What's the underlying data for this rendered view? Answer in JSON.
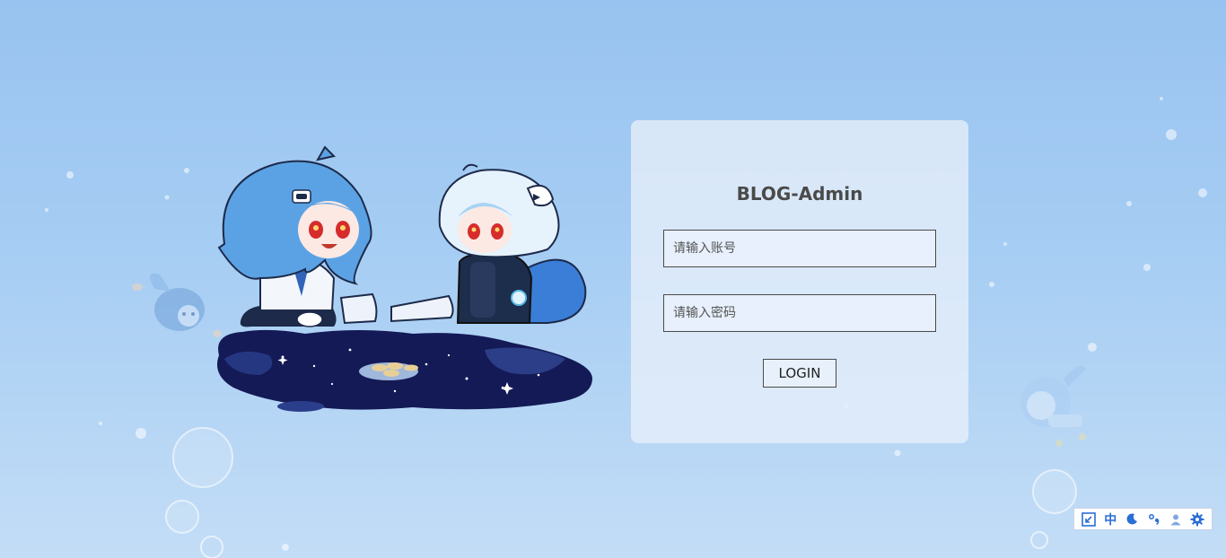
{
  "login": {
    "title": "BLOG-Admin",
    "account_placeholder": "请输入账号",
    "password_placeholder": "请输入密码",
    "submit_label": "LOGIN"
  },
  "ime_toolbar": {
    "items": [
      {
        "icon": "ime-switch-icon"
      },
      {
        "icon": "chinese-mode-icon",
        "label": "中"
      },
      {
        "icon": "half-width-moon-icon"
      },
      {
        "icon": "punctuation-icon"
      },
      {
        "icon": "user-icon"
      },
      {
        "icon": "settings-gear-icon"
      }
    ]
  },
  "colors": {
    "background_top": "#98c3f0",
    "background_bottom": "#c3ddf6",
    "accent": "#2a6ed6",
    "text": "#4a4a4a"
  }
}
